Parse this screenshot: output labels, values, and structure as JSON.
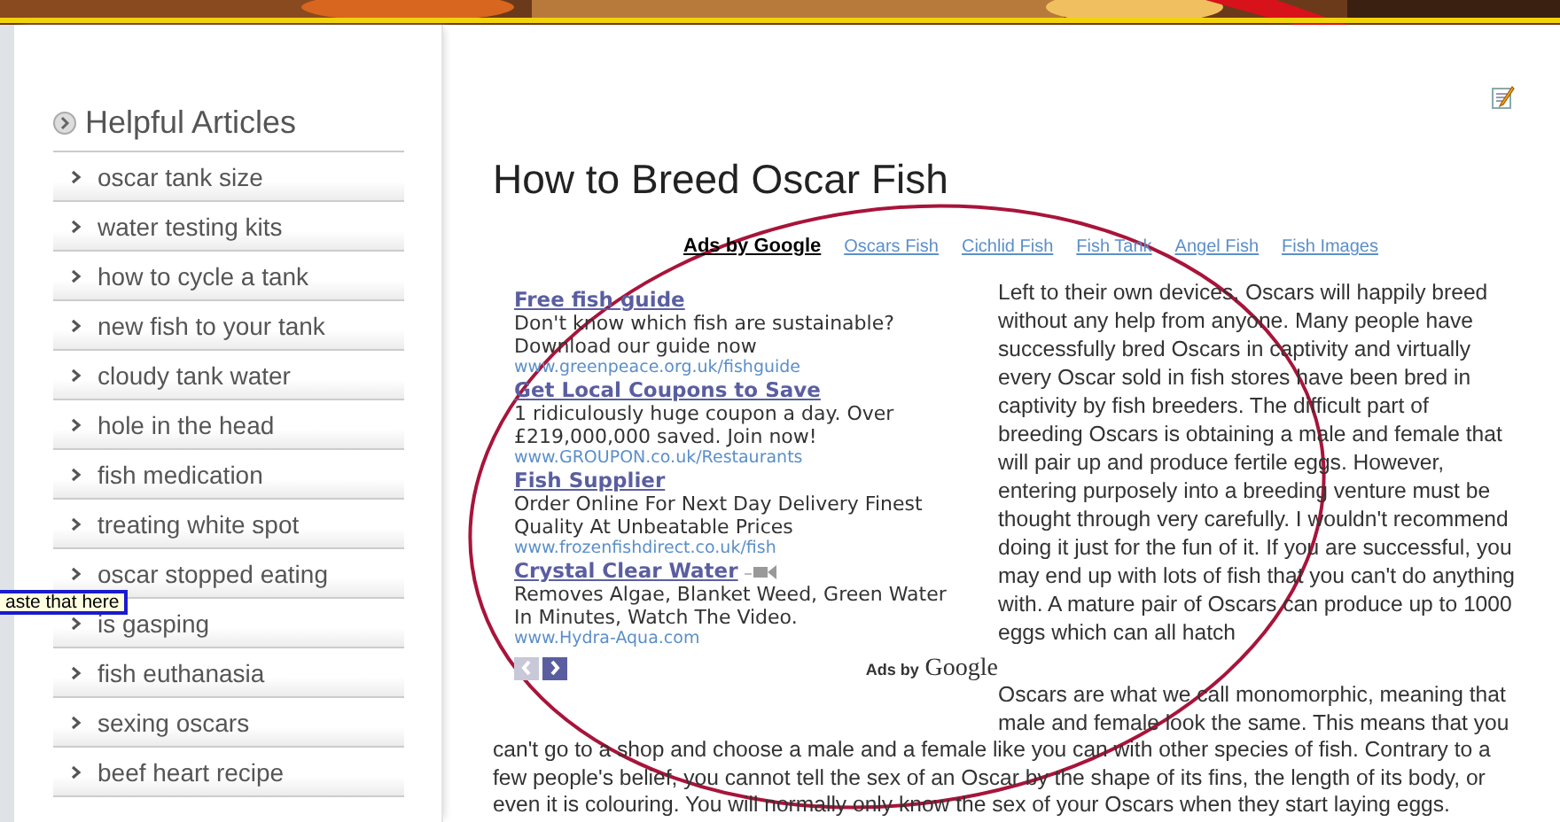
{
  "sidebar": {
    "title": "Helpful Articles",
    "items": [
      {
        "label": "oscar tank size"
      },
      {
        "label": "water testing kits"
      },
      {
        "label": "how to cycle a tank"
      },
      {
        "label": "new fish to your tank"
      },
      {
        "label": "cloudy tank water"
      },
      {
        "label": "hole in the head"
      },
      {
        "label": "fish medication"
      },
      {
        "label": "treating white spot"
      },
      {
        "label": "oscar stopped eating"
      },
      {
        "label": "is gasping"
      },
      {
        "label": "fish euthanasia"
      },
      {
        "label": "sexing oscars"
      },
      {
        "label": "beef heart recipe"
      }
    ]
  },
  "tooltip": {
    "text": "aste that here"
  },
  "article": {
    "title": "How to Breed Oscar Fish",
    "ad_links": {
      "heading": "Ads by Google",
      "links": [
        "Oscars Fish",
        "Cichlid Fish",
        "Fish Tank",
        "Angel Fish",
        "Fish Images"
      ]
    },
    "ads": [
      {
        "title": "Free fish guide",
        "lines": [
          "Don't know which fish are sustainable?",
          "Download our guide now"
        ],
        "url": "www.greenpeace.org.uk/fishguide",
        "video": false
      },
      {
        "title": "Get Local Coupons to Save",
        "lines": [
          "1 ridiculously huge coupon a day. Over",
          "£219,000,000 saved. Join now!"
        ],
        "url": "www.GROUPON.co.uk/Restaurants",
        "video": false
      },
      {
        "title": "Fish Supplier",
        "lines": [
          "Order Online For Next Day Delivery Finest",
          "Quality At Unbeatable Prices"
        ],
        "url": "www.frozenfishdirect.co.uk/fish",
        "video": false
      },
      {
        "title": "Crystal Clear Water",
        "lines": [
          "Removes Algae, Blanket Weed, Green Water",
          "In Minutes, Watch The Video."
        ],
        "url": "www.Hydra-Aqua.com",
        "video": true
      }
    ],
    "pager": [
      {
        "disabled": true
      },
      {
        "disabled": false
      }
    ],
    "ads_footer": {
      "prefix": "Ads by",
      "brand": "Google"
    },
    "paragraphs": [
      "Left to their own devices, Oscars will happily breed without any help from anyone. Many people have successfully bred Oscars in captivity and virtually every Oscar sold in fish stores have been bred in captivity by fish breeders. The difficult part of breeding Oscars is obtaining a male and female that will pair up and produce fertile eggs. However, entering purposely into a breeding venture must be thought through very carefully. I wouldn't recommend doing it just for the fun of it. If you are successful, you may end up with lots of fish that you can't do anything with. A mature pair of Oscars can produce up to 1000 eggs which can all hatch",
      "Oscars are what we call monomorphic, meaning that male and female look the same. This means that you can't go to a shop and choose a male and a female like you can with other species of fish. Contrary to a few people's belief, you cannot tell the sex of an Oscar by the shape of its fins, the length of its body, or even it is colouring. You will normally only know the sex of your Oscars when they start laying eggs."
    ]
  }
}
